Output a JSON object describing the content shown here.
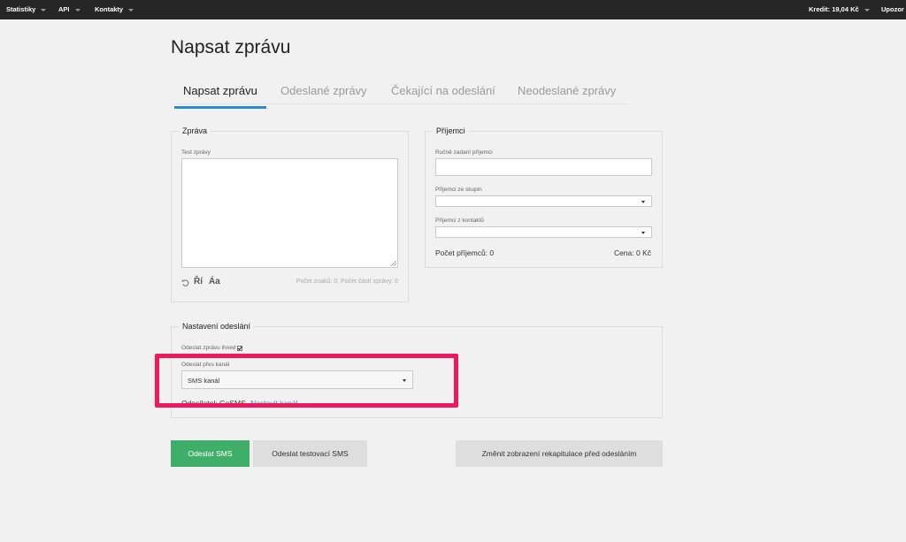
{
  "topbar": {
    "nav": [
      "Statistiky",
      "API",
      "Kontakty"
    ],
    "credit": "Kredit: 19,04 Kč",
    "notifications": "Upozor"
  },
  "page_title": "Napsat zprávu",
  "tabs": [
    "Napsat zprávu",
    "Odeslané zprávy",
    "Čekající na odeslání",
    "Neodeslané zprávy"
  ],
  "message_panel": {
    "legend": "Zpráva",
    "text_label": "Test zprávy",
    "text_value": "",
    "tool_diacritics": "Ří",
    "tool_case": "Áa",
    "counter": "Počet znaků: 0, Počet částí zprávy: 0"
  },
  "recipients_panel": {
    "legend": "Příjemci",
    "manual_label": "Ručně zadaní příjemci",
    "manual_value": "",
    "groups_label": "Příjemci ze skupin",
    "groups_value": "",
    "contacts_label": "Příjemci z kontaktů",
    "contacts_value": "",
    "count_text": "Počet příjemců: 0",
    "price_text": "Cena: 0 Kč"
  },
  "send_settings": {
    "legend": "Nastavení odeslání",
    "send_now_label": "Odeslat zprávu ihned",
    "send_now_checked": true,
    "channel_label": "Odeslat přes kanál",
    "channel_value": "SMS kanál",
    "sender_label": "Odesílatel: GoSMS",
    "sender_link": "Nastavit kanál"
  },
  "buttons": {
    "send": "Odeslat SMS",
    "send_test": "Odeslat testovací SMS",
    "toggle_summary": "Změnit zobrazení rekapitulace před odesláním"
  },
  "colors": {
    "primary": "#3fae69",
    "tab_active": "#2a8bcf",
    "highlight": "#f0185c",
    "topbar": "#262626",
    "link": "#2a8bcf"
  }
}
